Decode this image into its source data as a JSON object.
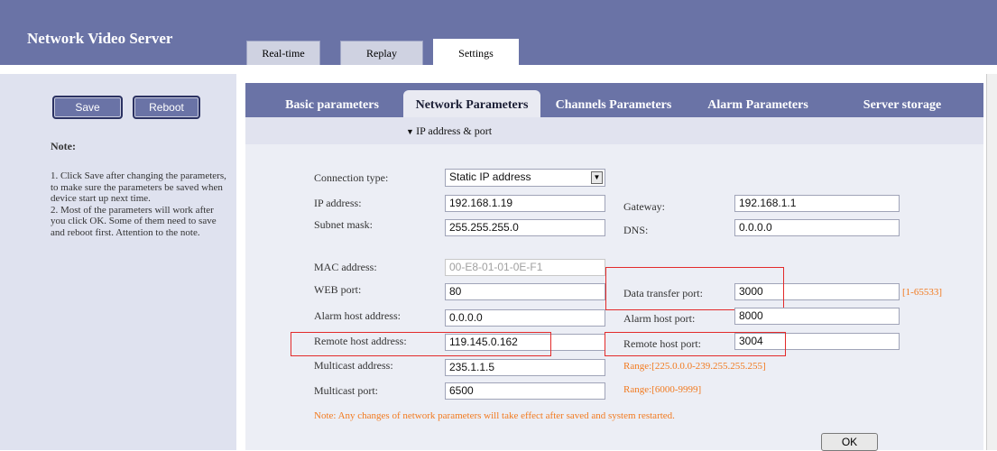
{
  "app": {
    "title": "Network Video Server"
  },
  "main_tabs": [
    {
      "label": "Real-time",
      "active": false
    },
    {
      "label": "Replay",
      "active": false
    },
    {
      "label": "Settings",
      "active": true
    }
  ],
  "sidebar": {
    "save_label": "Save",
    "reboot_label": "Reboot",
    "note_title": "Note:",
    "note_item1": "1. Click Save after changing the parameters, to make sure the parameters be saved when device start up next time.",
    "note_item2": "2. Most of the parameters will work after you click OK. Some of them need to save and reboot first. Attention to the note."
  },
  "subtabs": [
    {
      "label": "Basic parameters",
      "active": false
    },
    {
      "label": "Network Parameters",
      "active": true
    },
    {
      "label": "Channels Parameters",
      "active": false
    },
    {
      "label": "Alarm Parameters",
      "active": false
    },
    {
      "label": "Server storage",
      "active": false
    }
  ],
  "section": {
    "label": "IP address & port"
  },
  "form": {
    "connection_type_label": "Connection type:",
    "connection_type_value": "Static IP address",
    "ip_label": "IP address:",
    "ip_value": "192.168.1.19",
    "gateway_label": "Gateway:",
    "gateway_value": "192.168.1.1",
    "subnet_label": "Subnet mask:",
    "subnet_value": "255.255.255.0",
    "dns_label": "DNS:",
    "dns_value": "0.0.0.0",
    "mac_label": "MAC address:",
    "mac_value": "00-E8-01-01-0E-F1",
    "web_port_label": "WEB port:",
    "web_port_value": "80",
    "data_port_label": "Data transfer port:",
    "data_port_value": "3000",
    "data_port_range": "[1-65533]",
    "alarm_host_label": "Alarm host address:",
    "alarm_host_value": "0.0.0.0",
    "alarm_port_label": "Alarm host port:",
    "alarm_port_value": "8000",
    "remote_host_label": "Remote host address:",
    "remote_host_value": "119.145.0.162",
    "remote_port_label": "Remote host port:",
    "remote_port_value": "3004",
    "multicast_addr_label": "Multicast address:",
    "multicast_addr_value": "235.1.1.5",
    "multicast_addr_range": "Range:[225.0.0.0-239.255.255.255]",
    "multicast_port_label": "Multicast port:",
    "multicast_port_value": "6500",
    "multicast_port_range": "Range:[6000-9999]",
    "note": "Note: Any changes of network parameters will take effect after saved and system restarted.",
    "ok_label": "OK"
  },
  "colors": {
    "header": "#6a73a6",
    "sidebar_bg": "#dfe2ef",
    "content_bg": "#eceef5",
    "hint_orange": "#f27a1f",
    "highlight_red": "#e32a2a"
  }
}
